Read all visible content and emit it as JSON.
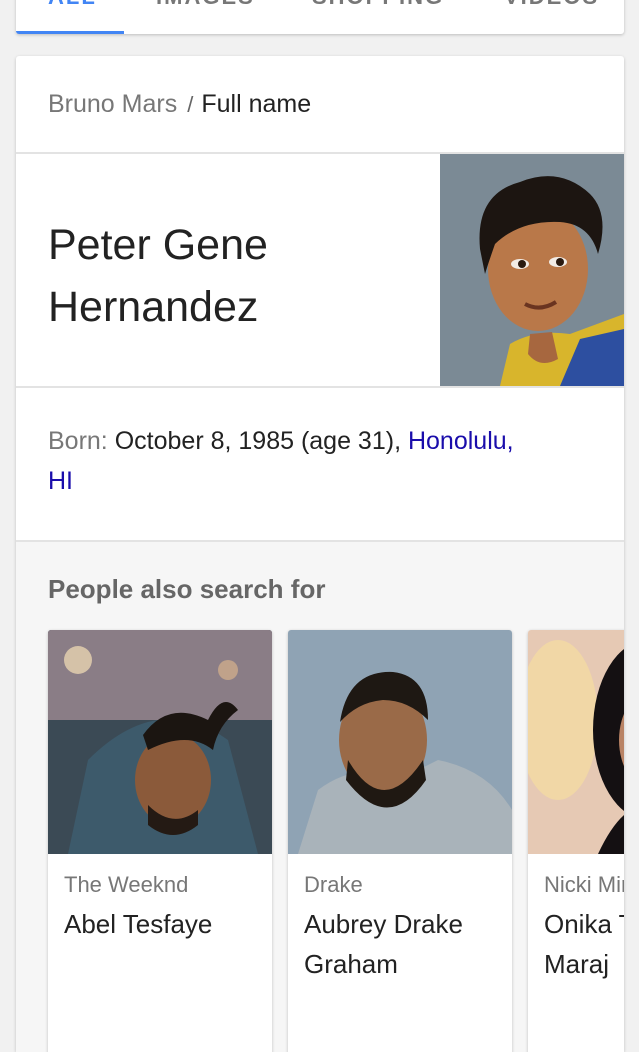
{
  "tabs": [
    {
      "label": "ALL",
      "active": true
    },
    {
      "label": "IMAGES",
      "active": false
    },
    {
      "label": "SHOPPING",
      "active": false
    },
    {
      "label": "VIDEOS",
      "active": false
    }
  ],
  "breadcrumb": {
    "parent": "Bruno Mars",
    "separator": "/",
    "current": "Full name"
  },
  "answer": {
    "line1": "Peter Gene",
    "line2": "Hernandez"
  },
  "portrait": {
    "icon": "person-photo"
  },
  "born": {
    "label": "Born:",
    "value": "October 8, 1985 (age 31), ",
    "place_line1": "Honolulu,",
    "place_line2": "HI"
  },
  "people_also_search": {
    "title": "People also search for",
    "people": [
      {
        "nick": "The Weeknd",
        "name_line1": "Abel Tesfaye",
        "name_line2": ""
      },
      {
        "nick": "Drake",
        "name_line1": "Aubrey Drake",
        "name_line2": "Graham"
      },
      {
        "nick": "Nicki Minaj",
        "name_line1": "Onika Tanya",
        "name_line2": "Maraj"
      }
    ]
  },
  "colors": {
    "accent": "#4285f4",
    "link": "#1a0dab",
    "muted": "#777777"
  }
}
